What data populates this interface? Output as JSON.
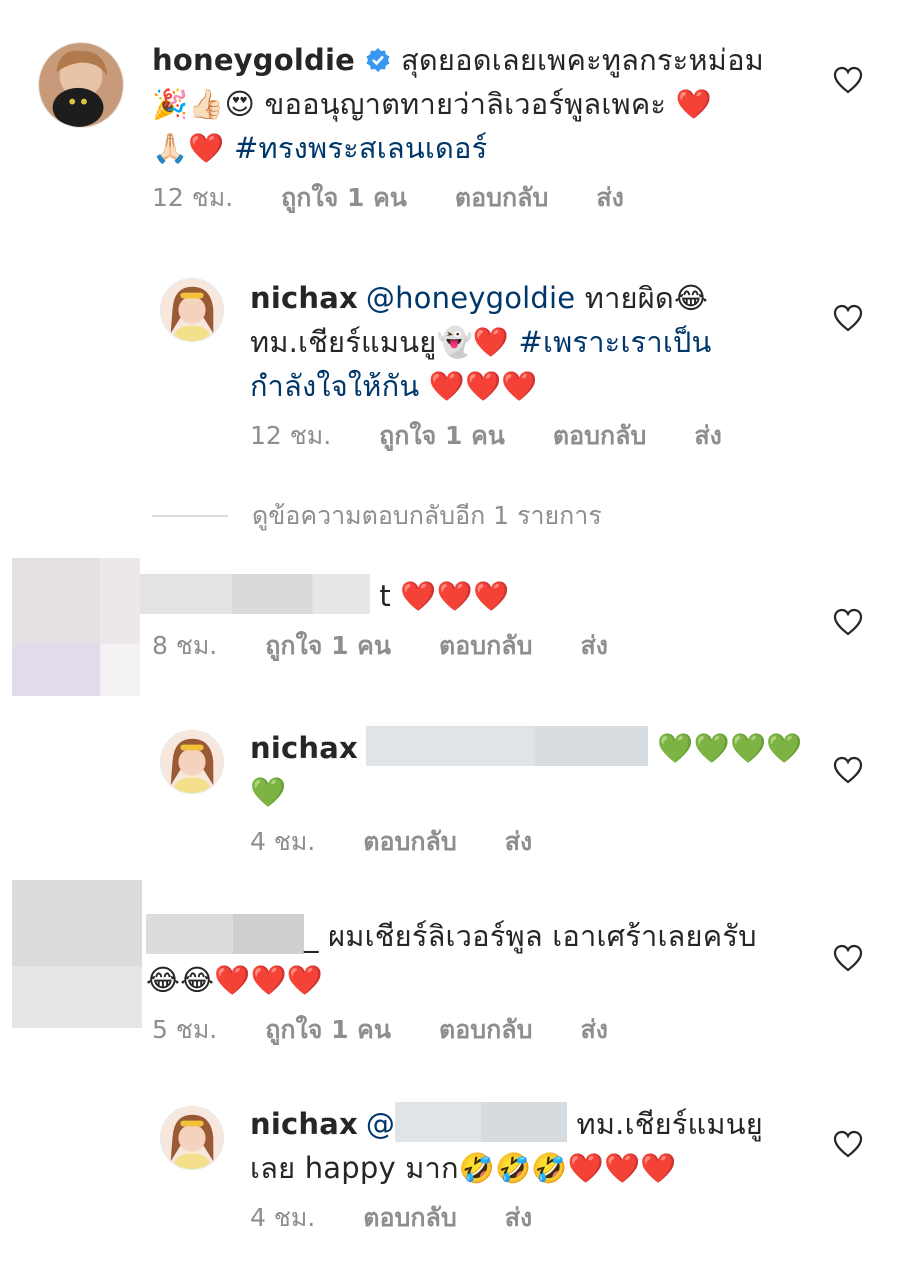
{
  "comments": [
    {
      "username": "honeygoldie",
      "text": "สุดยอดเลยเพคะทูลกระหม่อม",
      "line2": "🎉👍🏻😍 ขออนุญาตทายว่าลิเวอร์พูลเพคะ ❤️",
      "line3_emoji": "🙏🏻❤️",
      "hashtag": "#ทรงพระสเลนเดอร์",
      "time": "12 ชม.",
      "likes": "ถูกใจ 1 คน",
      "reply": "ตอบกลับ",
      "send": "ส่ง"
    },
    {
      "username": "nichax",
      "mention": "@honeygoldie",
      "text": "ทายผิด😂",
      "line2": "ทม.เชียร์แมนยู👻❤️",
      "hashtag_a": "#เพราะเราเป็น",
      "hashtag_b": "กำลังใจให้กัน",
      "hearts": "❤️❤️❤️",
      "time": "12 ชม.",
      "likes": "ถูกใจ 1 คน",
      "reply": "ตอบกลับ",
      "send": "ส่ง"
    },
    {
      "text": "t ❤️❤️❤️",
      "time": "8 ชม.",
      "likes": "ถูกใจ 1 คน",
      "reply": "ตอบกลับ",
      "send": "ส่ง"
    },
    {
      "username": "nichax",
      "hearts_a": "💚💚💚💚",
      "hearts_b": "💚",
      "time": "4 ชม.",
      "reply": "ตอบกลับ",
      "send": "ส่ง"
    },
    {
      "text": "_ ผมเชียร์ลิเวอร์พูล เอาเศร้าเลยครับ",
      "line2": "😂😂❤️❤️❤️",
      "time": "5 ชม.",
      "likes": "ถูกใจ 1 คน",
      "reply": "ตอบกลับ",
      "send": "ส่ง"
    },
    {
      "username": "nichax",
      "mention": "@",
      "text": "ทม.เชียร์แมนยู",
      "line2": "เลย happy มาก🤣🤣🤣❤️❤️❤️",
      "time": "4 ชม.",
      "reply": "ตอบกลับ",
      "send": "ส่ง"
    }
  ],
  "view_more_replies": "ดูข้อความตอบกลับอีก 1 รายการ",
  "colors": {
    "link": "#00376b",
    "meta": "#8e8e8e",
    "verified": "#3897f0"
  }
}
